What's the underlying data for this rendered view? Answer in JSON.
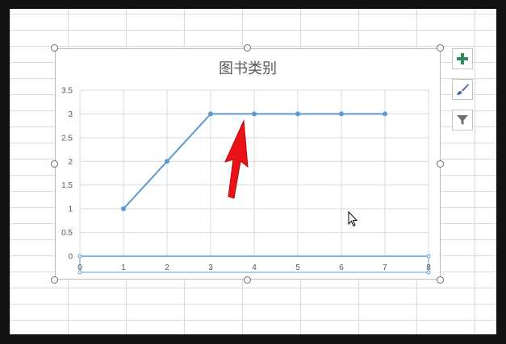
{
  "chart_data": {
    "type": "line",
    "title": "图书类别",
    "x": [
      1,
      2,
      3,
      4,
      5,
      6,
      7
    ],
    "series": [
      {
        "values": [
          1,
          2,
          3,
          3,
          3,
          3,
          3
        ],
        "color": "#5b9bd5"
      }
    ],
    "xlim": [
      0,
      8
    ],
    "ylim": [
      0,
      3.5
    ],
    "xticks": [
      "0",
      "1",
      "2",
      "3",
      "4",
      "5",
      "6",
      "7",
      "8"
    ],
    "yticks": [
      "0",
      "0.5",
      "1",
      "1.5",
      "2",
      "2.5",
      "3",
      "3.5"
    ],
    "grid": true,
    "legend": "none"
  },
  "side_buttons": {
    "add": "plus-icon",
    "style": "brush-icon",
    "filter": "funnel-icon"
  },
  "colors": {
    "accent": "#5b9bd5",
    "plus": "#2e8b57",
    "arrow": "#e8141a"
  }
}
